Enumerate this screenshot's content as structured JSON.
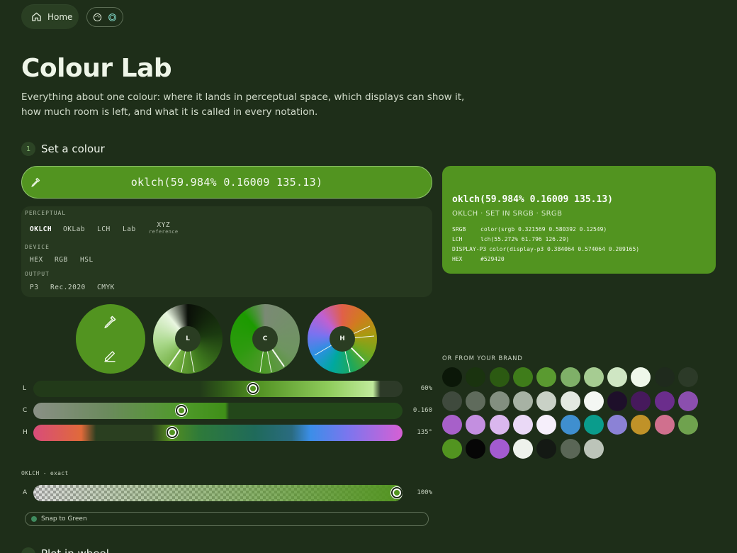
{
  "nav": {
    "home_label": "Home"
  },
  "page": {
    "title": "Colour Lab",
    "lead": "Everything about one colour: where it lands in perceptual space, which displays can show it, how much room is left, and what it is called in every notation."
  },
  "step1": {
    "number": "1",
    "title": "Set a colour"
  },
  "colour_input": {
    "value": "oklch(59.984% 0.16009 135.13)"
  },
  "notations": {
    "perceptual_label": "PERCEPTUAL",
    "perceptual": [
      "OKLCH",
      "OKLab",
      "LCH",
      "Lab",
      "XYZ"
    ],
    "xyz_note": "reference",
    "device_label": "DEVICE",
    "device": [
      "HEX",
      "RGB",
      "HSL"
    ],
    "output_label": "OUTPUT",
    "output": [
      "P3",
      "Rec.2020",
      "CMYK"
    ],
    "active": "OKLCH"
  },
  "preview": {
    "color": "#529420",
    "title": "oklch(59.984% 0.16009 135.13)",
    "subtitle": "OKLCH · SET IN SRGB · SRGB",
    "rows": [
      {
        "k": "SRGB",
        "v": "color(srgb 0.321569 0.580392 0.12549)"
      },
      {
        "k": "LCH",
        "v": "lch(55.272% 61.796 126.29)"
      },
      {
        "k": "DISPLAY-P3",
        "v": "color(display-p3 0.384064 0.574064 0.209165)"
      },
      {
        "k": "HEX",
        "v": "#529420"
      }
    ]
  },
  "wheels": {
    "l_label": "L",
    "c_label": "C",
    "h_label": "H"
  },
  "sliders": {
    "l": {
      "label": "L",
      "value": "60%",
      "fraction": 0.6
    },
    "c": {
      "label": "C",
      "value": "0.160",
      "fraction": 0.4
    },
    "h": {
      "label": "H",
      "value": "135°",
      "fraction": 0.375
    },
    "exact_label": "OKLCH - exact",
    "a": {
      "label": "A",
      "value": "100%",
      "fraction": 1.0
    }
  },
  "snap": {
    "label": "Snap to Green"
  },
  "brand": {
    "label": "OR FROM YOUR BRAND",
    "swatches": [
      "#0b1708",
      "#1a330f",
      "#2c5a12",
      "#3f7c1a",
      "#5a9a30",
      "#7fb068",
      "#a6cc92",
      "#cfe6c3",
      "#eef7ea",
      "#1f2a1d",
      "#2c3a28",
      "#3f4a3d",
      "#5f6b5c",
      "#838f80",
      "#a7b2a4",
      "#c9d1c6",
      "#e3e9e1",
      "#f4f7f3",
      "#1e0f2a",
      "#46195c",
      "#6b2d8c",
      "#8b4fae",
      "#a760c9",
      "#c38fe0",
      "#dab7ee",
      "#ead9f6",
      "#f6effb",
      "#3f8fcf",
      "#0a9c8c",
      "#8b82d6",
      "#c09228",
      "#d0708e",
      "#6fa24e",
      "#529420",
      "#060606",
      "#a35bd0",
      "#eef2ec",
      "#141914",
      "#5a6656",
      "#bcc4b9"
    ]
  },
  "step2": {
    "title": "Plot in wheel"
  }
}
